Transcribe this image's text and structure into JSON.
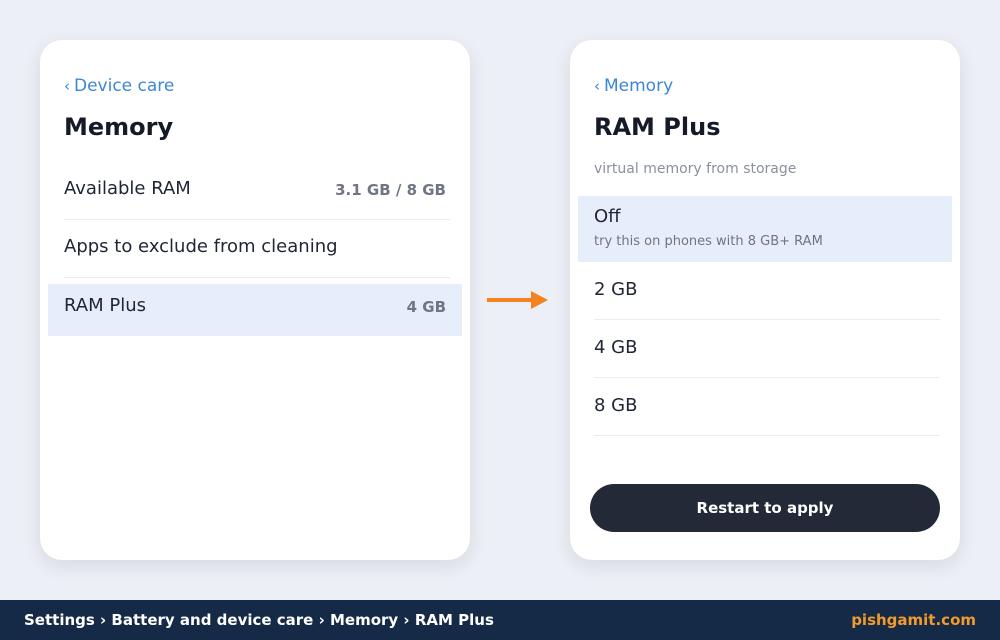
{
  "left_screen": {
    "back_label": "Device care",
    "title": "Memory",
    "rows": [
      {
        "label": "Available RAM",
        "value": "3.1 GB / 8 GB"
      },
      {
        "label": "Apps to exclude from cleaning",
        "value": ""
      },
      {
        "label": "RAM Plus",
        "value": "4 GB",
        "selected": true
      }
    ]
  },
  "right_screen": {
    "back_label": "Memory",
    "title": "RAM Plus",
    "subtitle": "virtual memory from storage",
    "options": [
      {
        "label": "Off",
        "hint": "try this on phones with 8 GB+ RAM",
        "selected": true
      },
      {
        "label": "2 GB"
      },
      {
        "label": "4 GB"
      },
      {
        "label": "8 GB"
      }
    ],
    "restart_label": "Restart to apply"
  },
  "footer": {
    "breadcrumb": "Settings › Battery and device care › Memory › RAM Plus",
    "brand": "pishgamit.com"
  },
  "colors": {
    "background": "#eceff5",
    "accent_link": "#3c86d6",
    "selected_row": "#e6eefb",
    "arrow": "#f58220",
    "button": "#232937",
    "footer_bg": "#142a47",
    "brand": "#f29a2e"
  },
  "icons": {
    "back": "chevron-left-icon",
    "flow": "arrow-right-icon"
  }
}
